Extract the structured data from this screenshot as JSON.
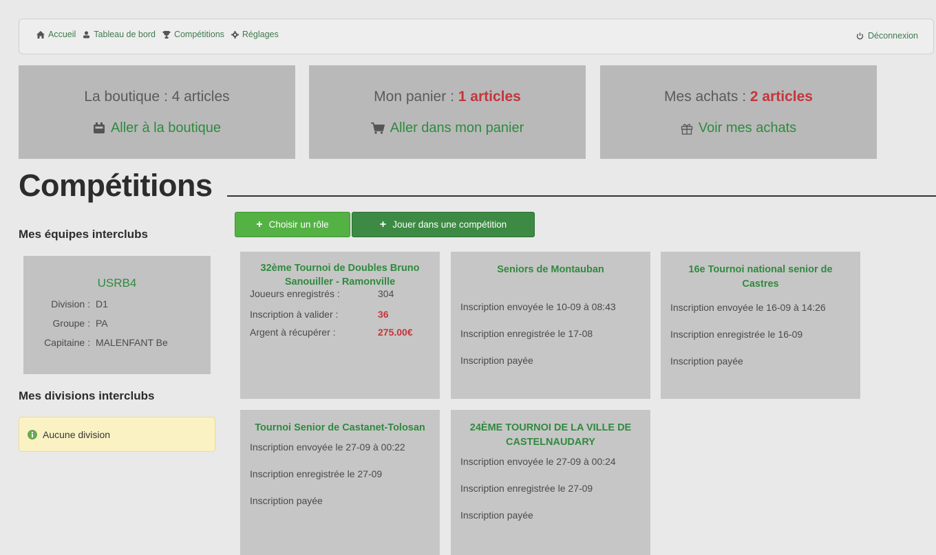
{
  "nav": {
    "items": [
      {
        "label": "Accueil",
        "icon": "home-icon"
      },
      {
        "label": "Tableau de bord",
        "icon": "user-icon"
      },
      {
        "label": "Compétitions",
        "icon": "trophy-icon"
      },
      {
        "label": "Réglages",
        "icon": "gear-icon"
      }
    ],
    "logout": "Déconnexion"
  },
  "stats": [
    {
      "title": "La boutique : 4 articles",
      "count": "",
      "link": "Aller à la boutique",
      "icon": "store-icon"
    },
    {
      "title": "Mon panier : ",
      "count": "1 articles",
      "link": "Aller dans mon panier",
      "icon": "cart-icon"
    },
    {
      "title": "Mes achats : ",
      "count": "2 articles",
      "link": "Voir mes achats",
      "icon": "gift-icon"
    }
  ],
  "page_title": "Compétitions",
  "sidebar": {
    "teams_heading": "Mes équipes interclubs",
    "team": {
      "name": "USRB4",
      "rows": [
        {
          "label": "Division :",
          "value": "D1"
        },
        {
          "label": "Groupe :",
          "value": "PA"
        },
        {
          "label": "Capitaine :",
          "value": "MALENFANT Be"
        }
      ]
    },
    "divisions_heading": "Mes divisions interclubs",
    "no_division": "Aucune division"
  },
  "buttons": {
    "choose_role": "Choisir un rôle",
    "play": "Jouer dans une compétition"
  },
  "competitions": {
    "c1": {
      "title": "32ème Tournoi de Doubles Bruno Sanouiller - Ramonville",
      "rows": [
        {
          "label": "Joueurs enregistrés :",
          "value": "304"
        },
        {
          "label": "Inscription à valider :",
          "value": "36"
        },
        {
          "label": "Argent à récupérer :",
          "value": "275.00€"
        }
      ]
    },
    "c2": {
      "title": "Seniors de Montauban",
      "sent": "Inscription envoyée le 10-09 à 08:43",
      "registered": "Inscription enregistrée le 17-08",
      "paid": "Inscription payée"
    },
    "c3": {
      "title": "16e Tournoi national senior de Castres",
      "sent": "Inscription envoyée le 16-09 à 14:26",
      "registered": "Inscription enregistrée le 16-09",
      "paid": "Inscription payée"
    },
    "c4": {
      "title": "Tournoi Senior de Castanet-Tolosan",
      "sent": "Inscription envoyée le 27-09 à 00:22",
      "registered": "Inscription enregistrée le 27-09",
      "paid": "Inscription payée"
    },
    "c5": {
      "title": "24ÈME TOURNOI DE LA VILLE DE CASTELNAUDARY",
      "sent": "Inscription envoyée le 27-09 à 00:24",
      "registered": "Inscription enregistrée le 27-09",
      "paid": "Inscription payée"
    }
  },
  "colors": {
    "accent_green": "#2f8a3e",
    "alert_red": "#c4353b",
    "button_light_green": "#54b245",
    "button_dark_green": "#3c8a43"
  }
}
